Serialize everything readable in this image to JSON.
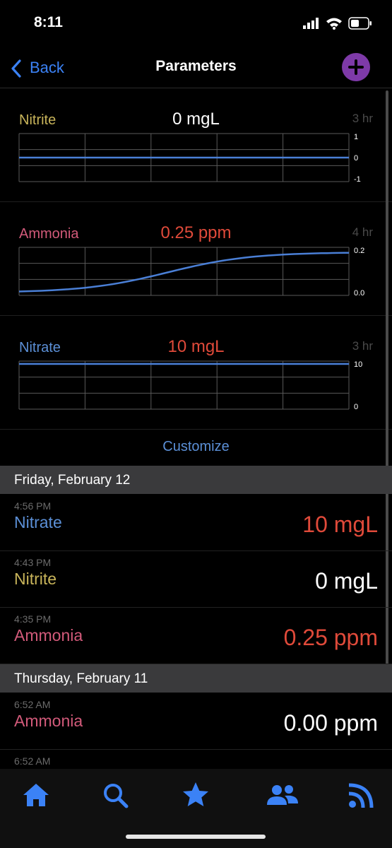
{
  "status": {
    "time": "8:11"
  },
  "nav": {
    "back_label": "Back",
    "title": "Parameters"
  },
  "charts": [
    {
      "name": "Nitrite",
      "value": "0 mgL",
      "range": "3 hr",
      "name_color": "#c8b45a",
      "value_color": "#ffffff",
      "ticks": [
        "1",
        "0",
        "-1"
      ],
      "line": {
        "type": "flat",
        "value": 0
      }
    },
    {
      "name": "Ammonia",
      "value": "0.25 ppm",
      "range": "4 hr",
      "name_color": "#d25a7a",
      "value_color": "#e04a3a",
      "ticks": [
        "0.2",
        "0.0"
      ],
      "line": {
        "type": "sigmoid",
        "from": 0.0,
        "to": 0.25
      }
    },
    {
      "name": "Nitrate",
      "value": "10 mgL",
      "range": "3 hr",
      "name_color": "#5b8fd6",
      "value_color": "#e04a3a",
      "ticks": [
        "10",
        "0"
      ],
      "line": {
        "type": "flat",
        "value": 10
      }
    }
  ],
  "customize_label": "Customize",
  "days": [
    {
      "date": "Friday, February 12",
      "entries": [
        {
          "time": "4:56 PM",
          "name": "Nitrate",
          "value": "10 mgL",
          "name_color": "#5b8fd6",
          "value_color": "#e04a3a"
        },
        {
          "time": "4:43 PM",
          "name": "Nitrite",
          "value": "0 mgL",
          "name_color": "#c8b45a",
          "value_color": "#ffffff"
        },
        {
          "time": "4:35 PM",
          "name": "Ammonia",
          "value": "0.25 ppm",
          "name_color": "#d25a7a",
          "value_color": "#e04a3a"
        }
      ]
    },
    {
      "date": "Thursday, February 11",
      "entries": [
        {
          "time": "6:52 AM",
          "name": "Ammonia",
          "value": "0.00 ppm",
          "name_color": "#d25a7a",
          "value_color": "#ffffff"
        },
        {
          "time": "6:52 AM",
          "name": "",
          "value": "",
          "name_color": "#ffffff",
          "value_color": "#ffffff"
        }
      ]
    }
  ],
  "tabs": [
    {
      "icon": "home-icon"
    },
    {
      "icon": "search-icon"
    },
    {
      "icon": "star-icon"
    },
    {
      "icon": "people-icon"
    },
    {
      "icon": "rss-icon"
    }
  ],
  "colors": {
    "accent": "#3b82f6",
    "chart_line": "#4a7fd6",
    "add_button": "#7e3aa8"
  }
}
